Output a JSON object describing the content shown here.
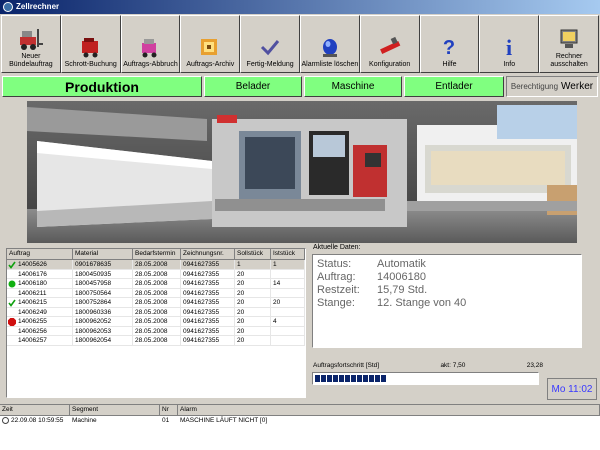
{
  "window": {
    "title": "Zellrechner"
  },
  "toolbar": [
    {
      "label": "Neuer Bündelauftrag",
      "icon": "forklift-icon",
      "name": "neuer-buendelauftrag-button"
    },
    {
      "label": "Schrott-Buchung",
      "icon": "scrap-cart-icon",
      "name": "schrott-buchung-button"
    },
    {
      "label": "Auftrags-Abbruch",
      "icon": "abort-order-icon",
      "name": "auftrags-abbruch-button"
    },
    {
      "label": "Auftrags-Archiv",
      "icon": "archive-icon",
      "name": "auftrags-archiv-button"
    },
    {
      "label": "Fertig-Meldung",
      "icon": "checkmark-icon",
      "name": "fertig-meldung-button"
    },
    {
      "label": "Alarmliste löschen",
      "icon": "alarm-light-icon",
      "name": "alarmliste-loeschen-button"
    },
    {
      "label": "Konfiguration",
      "icon": "config-tool-icon",
      "name": "konfiguration-button"
    },
    {
      "label": "Hilfe",
      "icon": "help-icon",
      "name": "hilfe-button"
    },
    {
      "label": "Info",
      "icon": "info-icon",
      "name": "info-button"
    },
    {
      "label": "Rechner ausschalten",
      "icon": "power-off-icon",
      "name": "rechner-ausschalten-button"
    }
  ],
  "nav": {
    "produktion": "Produktion",
    "belader": "Belader",
    "maschine": "Maschine",
    "entlader": "Entlader",
    "berechtigung_label": "Berechtigung",
    "berechtigung_value": "Werker",
    "active_color": "#80ff80"
  },
  "table": {
    "headers": [
      "Auftrag",
      "Material",
      "Bedarfstermin",
      "Zeichnungsnr.",
      "Sollstück",
      "Iststück"
    ],
    "rows": [
      {
        "status": "check",
        "cells": [
          "14005626",
          "0901678635",
          "28.05.2008",
          "0941627355",
          "1",
          "1"
        ]
      },
      {
        "status": "none",
        "cells": [
          "14006176",
          "1800450935",
          "28.05.2008",
          "0941627355",
          "20",
          ""
        ]
      },
      {
        "status": "green",
        "cells": [
          "14006180",
          "1800457958",
          "28.05.2008",
          "0941627355",
          "20",
          "14"
        ]
      },
      {
        "status": "none",
        "cells": [
          "14006211",
          "1800750564",
          "28.05.2008",
          "0941627355",
          "20",
          ""
        ]
      },
      {
        "status": "check",
        "cells": [
          "14006215",
          "1800752864",
          "28.05.2008",
          "0941627355",
          "20",
          "20"
        ]
      },
      {
        "status": "none",
        "cells": [
          "14006249",
          "1800960336",
          "28.05.2008",
          "0941627355",
          "20",
          ""
        ]
      },
      {
        "status": "stop",
        "cells": [
          "14006255",
          "1800962052",
          "28.05.2008",
          "0941627355",
          "20",
          "4"
        ]
      },
      {
        "status": "none",
        "cells": [
          "14006256",
          "1800962053",
          "28.05.2008",
          "0941627355",
          "20",
          ""
        ]
      },
      {
        "status": "none",
        "cells": [
          "14006257",
          "1800962054",
          "28.05.2008",
          "0941627355",
          "20",
          ""
        ]
      }
    ]
  },
  "details": {
    "title": "Aktuelle Daten:",
    "rows": [
      {
        "key": "Status:",
        "value": "Automatik"
      },
      {
        "key": "Auftrag:",
        "value": "14006180"
      },
      {
        "key": "Restzeit:",
        "value": "15,79 Std."
      },
      {
        "key": "Stange:",
        "value": "12. Stange von 40"
      }
    ]
  },
  "progress": {
    "label": "Auftragsfortschritt [Std]",
    "current": "akt: 7,50",
    "total": "23,28",
    "fraction": 0.322
  },
  "clock": "Mo 11:02",
  "log": {
    "headers": [
      "Zeit",
      "Segment",
      "Nr",
      "Alarm"
    ],
    "rows": [
      {
        "cells": [
          "22.09.08 10:59:55",
          "Machine",
          "01",
          "MASCHINE LÄUFT NICHT [0]"
        ]
      }
    ]
  }
}
